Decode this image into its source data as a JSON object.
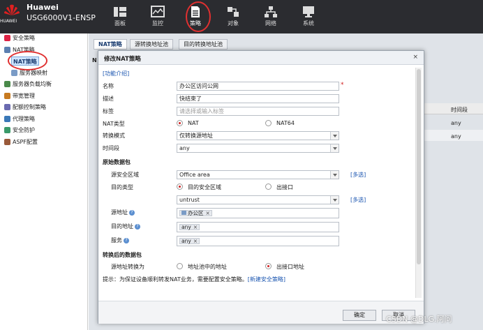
{
  "header": {
    "brand": "Huawei",
    "model": "USG6000V1-ENSP",
    "logo_text": "HUAWEI",
    "nav": [
      {
        "label": "面板",
        "icon": "dashboard-icon"
      },
      {
        "label": "监控",
        "icon": "monitor-icon"
      },
      {
        "label": "策略",
        "icon": "policy-icon"
      },
      {
        "label": "对象",
        "icon": "object-icon"
      },
      {
        "label": "网络",
        "icon": "network-icon"
      },
      {
        "label": "系统",
        "icon": "system-icon"
      }
    ]
  },
  "sidebar": {
    "items": [
      "安全策略",
      "NAT策略",
      "NAT策略",
      "服务器映射",
      "服务器负载均衡",
      "带宽管理",
      "配额控制策略",
      "代理策略",
      "安全防护",
      "ASPF配置"
    ]
  },
  "tabs": [
    "NAT策略",
    "源转换地址池",
    "目的转换地址池"
  ],
  "background": {
    "col_header": "时间段",
    "cells": [
      "any",
      "any"
    ],
    "stub": "N"
  },
  "dialog": {
    "title": "修改NAT策略",
    "close": "×",
    "help_link": "[功能介绍]",
    "fields": {
      "name_label": "名称",
      "name_value": "办公区访问公网",
      "required_mark": "*",
      "desc_label": "描述",
      "desc_value": "快结束了",
      "tag_label": "标签",
      "tag_placeholder": "请选择或输入标签",
      "nat_type_label": "NAT类型",
      "nat_type_opt1": "NAT",
      "nat_type_opt2": "NAT64",
      "mode_label": "转换模式",
      "mode_value": "仅转换源地址",
      "time_label": "时间段",
      "time_value": "any"
    },
    "original": {
      "section": "原始数据包",
      "src_zone_label": "源安全区域",
      "src_zone_value": "Office area",
      "multi1": "[多选]",
      "dst_type_label": "目的类型",
      "dst_type_opt1": "目的安全区域",
      "dst_type_opt2": "出接口",
      "dst_zone_value": "untrust",
      "multi2": "[多选]",
      "src_addr_label": "源地址",
      "src_addr_tag": "办公区",
      "dst_addr_label": "目的地址",
      "dst_addr_tag": "any",
      "service_label": "服务",
      "service_tag": "any",
      "help_q": "?",
      "tag_x": "×"
    },
    "translated": {
      "section": "转换后的数据包",
      "src_convert_label": "源地址转换为",
      "opt1": "地址池中的地址",
      "opt2": "出接口地址"
    },
    "hint": "提示：为保证设备顺利转发NAT业务，需要配置安全策略。",
    "hint_link": "[新建安全策略]",
    "ok_label": "确定",
    "cancel_label": "取消"
  },
  "watermark": "CSDN @DLG.阿问"
}
